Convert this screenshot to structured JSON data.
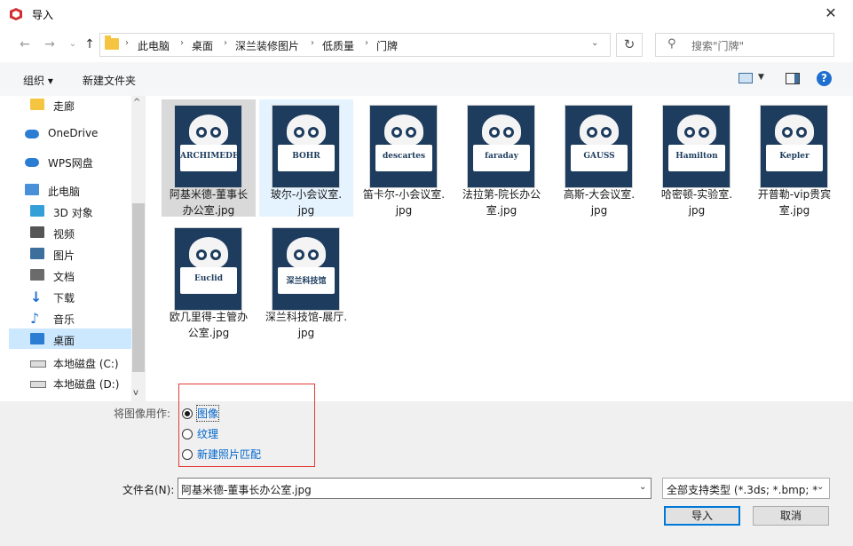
{
  "window": {
    "title": "导入"
  },
  "nav": {
    "breadcrumbs": [
      "此电脑",
      "桌面",
      "深兰装修图片",
      "低质量",
      "门牌"
    ],
    "search_placeholder": "搜索\"门牌\""
  },
  "toolbar": {
    "organize": "组织 ▾",
    "new_folder": "新建文件夹"
  },
  "sidebar": {
    "items": [
      {
        "label": "走廊",
        "icon": "folder-icon"
      },
      {
        "label": "OneDrive",
        "icon": "cloud-icon"
      },
      {
        "label": "WPS网盘",
        "icon": "cloud-icon"
      },
      {
        "label": "此电脑",
        "icon": "computer-icon"
      },
      {
        "label": "3D 对象",
        "icon": "cube-icon"
      },
      {
        "label": "视频",
        "icon": "video-icon"
      },
      {
        "label": "图片",
        "icon": "picture-icon"
      },
      {
        "label": "文档",
        "icon": "document-icon"
      },
      {
        "label": "下载",
        "icon": "download-icon"
      },
      {
        "label": "音乐",
        "icon": "music-icon"
      },
      {
        "label": "桌面",
        "icon": "desktop-icon"
      },
      {
        "label": "本地磁盘 (C:)",
        "icon": "drive-icon"
      },
      {
        "label": "本地磁盘 (D:)",
        "icon": "drive-icon"
      }
    ]
  },
  "files": [
    {
      "line1": "阿基米德-董事长",
      "line2": "办公室.jpg",
      "brand": "ARCHIMEDES",
      "selected": true
    },
    {
      "line1": "玻尔-小会议室.",
      "line2": "jpg",
      "brand": "BOHR",
      "hover": true
    },
    {
      "line1": "笛卡尔-小会议室.",
      "line2": "jpg",
      "brand": "descartes"
    },
    {
      "line1": "法拉第-院长办公",
      "line2": "室.jpg",
      "brand": "faraday"
    },
    {
      "line1": "高斯-大会议室.",
      "line2": "jpg",
      "brand": "GAUSS"
    },
    {
      "line1": "哈密顿-实验室.",
      "line2": "jpg",
      "brand": "Hamilton"
    },
    {
      "line1": "开普勒-vip贵宾",
      "line2": "室.jpg",
      "brand": "Kepler"
    },
    {
      "line1": "欧几里得-主管办",
      "line2": "公室.jpg",
      "brand": "Euclid"
    },
    {
      "line1": "深兰科技馆-展厅.",
      "line2": "jpg",
      "brand": "深兰科技馆"
    }
  ],
  "use_as": {
    "label": "将图像用作:",
    "options": [
      "图像",
      "纹理",
      "新建照片匹配"
    ],
    "selected": 0
  },
  "filename": {
    "label": "文件名(N):",
    "value": "阿基米德-董事长办公室.jpg"
  },
  "filetype": {
    "value": "全部支持类型 (*.3ds; *.bmp; *"
  },
  "buttons": {
    "open": "导入",
    "cancel": "取消"
  },
  "colors": {
    "accent": "#0078d7",
    "selection": "#cce8ff",
    "highlight_box": "#e53935"
  }
}
